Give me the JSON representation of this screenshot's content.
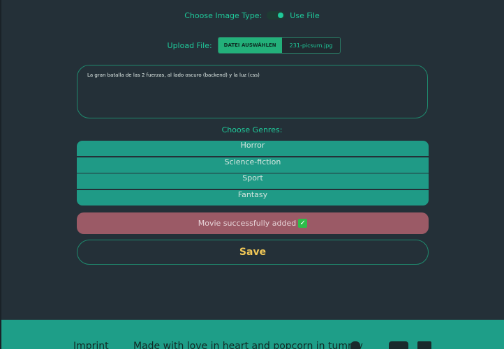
{
  "image_type": {
    "label": "Choose Image Type:",
    "toggle_label": "Use File",
    "toggle_on": true
  },
  "upload": {
    "label": "Upload File:",
    "button_label": "DATEI AUSWÄHLEN",
    "file_name": "231-picsum.jpg"
  },
  "description": {
    "value": "La gran batalla de las 2 fuerzas, al lado oscuro (backend) y la luz (css)"
  },
  "genres": {
    "label": "Choose Genres:",
    "items": [
      "Horror",
      "Science-fiction",
      "Sport",
      "Fantasy"
    ]
  },
  "status": {
    "message": "Movie successfully added",
    "icon": "check-mark-button-emoji"
  },
  "save": {
    "label": "Save"
  },
  "footer": {
    "imprint": "Imprint",
    "tagline": "Made with love in heart and popcorn in tummy"
  },
  "colors": {
    "background": "#243038",
    "accent": "#1fc99a",
    "genre_bg": "#1f9a86",
    "success_bg": "#9b5a66",
    "save_text": "#f2c857",
    "footer_bg": "#1e9e88"
  }
}
